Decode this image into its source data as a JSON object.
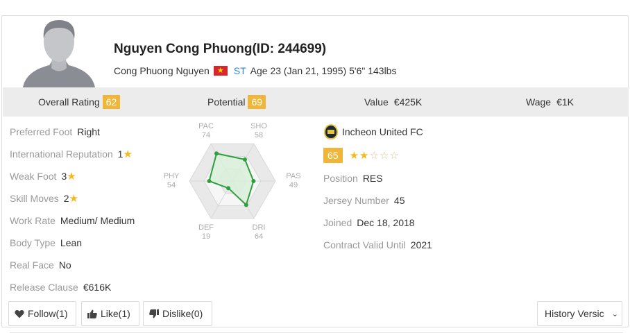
{
  "player": {
    "name_line": "Nguyen Cong Phuong(ID: 244699)",
    "full_name": "Cong Phuong Nguyen",
    "flag_icon": "vietnam-flag-icon",
    "position": "ST",
    "age_info": "Age 23 (Jan 21, 1995) 5'6\" 143lbs"
  },
  "stats_bar": {
    "overall_label": "Overall Rating",
    "overall_value": "62",
    "potential_label": "Potential",
    "potential_value": "69",
    "value_label": "Value",
    "value_value": "€425K",
    "wage_label": "Wage",
    "wage_value": "€1K"
  },
  "profile": [
    {
      "label": "Preferred Foot",
      "value": "Right",
      "star": false
    },
    {
      "label": "International Reputation",
      "value": "1",
      "star": true
    },
    {
      "label": "Weak Foot",
      "value": "3",
      "star": true
    },
    {
      "label": "Skill Moves",
      "value": "2",
      "star": true
    },
    {
      "label": "Work Rate",
      "value": "Medium/ Medium",
      "star": false
    },
    {
      "label": "Body Type",
      "value": "Lean",
      "star": false
    },
    {
      "label": "Real Face",
      "value": "No",
      "star": false
    },
    {
      "label": "Release Clause",
      "value": "€616K",
      "star": false
    }
  ],
  "radar": {
    "axes": [
      {
        "label": "PAC",
        "value": 74
      },
      {
        "label": "SHO",
        "value": 58
      },
      {
        "label": "PAS",
        "value": 49
      },
      {
        "label": "DRI",
        "value": 64
      },
      {
        "label": "DEF",
        "value": 19
      },
      {
        "label": "PHY",
        "value": 54
      }
    ],
    "line_color": "#2e9e3e",
    "fill_color": "#d9efd9"
  },
  "club": {
    "name": "Incheon United FC",
    "crest_icon": "club-crest-icon",
    "rating": "65",
    "stars_filled": 2,
    "stars_total": 5,
    "details": [
      {
        "label": "Position",
        "value": "RES"
      },
      {
        "label": "Jersey Number",
        "value": "45"
      },
      {
        "label": "Joined",
        "value": "Dec 18, 2018"
      },
      {
        "label": "Contract Valid Until",
        "value": "2021"
      }
    ]
  },
  "actions": {
    "follow_label": "Follow(1)",
    "like_label": "Like(1)",
    "dislike_label": "Dislike(0)",
    "history_label": "History Versic"
  },
  "colors": {
    "badge": "#f0b63a",
    "star": "#f3b91f",
    "position": "#2a86d8",
    "stats_bg": "#ececec"
  }
}
